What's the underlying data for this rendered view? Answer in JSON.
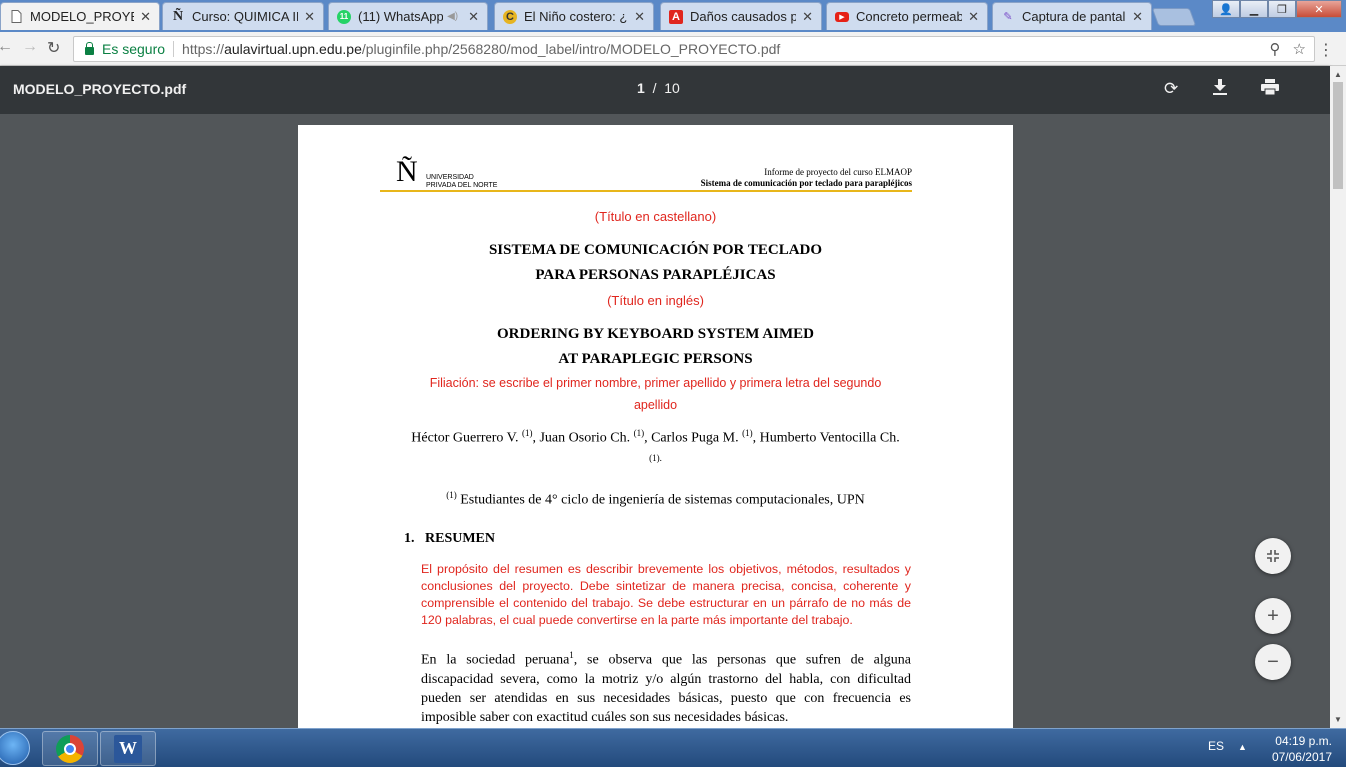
{
  "browser": {
    "tabs": [
      {
        "label": "MODELO_PROYECT",
        "icon": "document-icon",
        "active": true
      },
      {
        "label": "Curso: QUIMICA IN",
        "icon": "upn-icon"
      },
      {
        "label": "(11) WhatsApp",
        "icon": "whatsapp-icon"
      },
      {
        "label": "El Niño costero: ¿Q",
        "icon": "news-icon"
      },
      {
        "label": "Daños causados po",
        "icon": "pdf-icon"
      },
      {
        "label": "Concreto permeabl",
        "icon": "youtube-icon"
      },
      {
        "label": "Captura de pantalla",
        "icon": "pen-icon"
      }
    ],
    "whatsapp_badge": "11",
    "secure_label": "Es seguro",
    "url_prefix": "https://",
    "url_host": "aulavirtual.upn.edu.pe",
    "url_path": "/pluginfile.php/2568280/mod_label/intro/MODELO_PROYECTO.pdf"
  },
  "pdf_toolbar": {
    "filename": "MODELO_PROYECTO.pdf",
    "current_page": "1",
    "page_sep": "/",
    "total_pages": "10"
  },
  "document": {
    "logo_letter": "Ñ",
    "logo_line1": "UNIVERSIDAD",
    "logo_line2": "PRIVADA DEL NORTE",
    "header_line1": "Informe de proyecto del curso ELMAOP",
    "header_line2": "Sistema de comunicación por teclado para parapléjicos",
    "title_es_note": "(Título en castellano)",
    "title_es_1": "SISTEMA DE COMUNICACIÓN POR TECLADO",
    "title_es_2": "PARA PERSONAS PARAPLÉJICAS",
    "title_en_note": "(Título en inglés)",
    "title_en_1": "ORDERING BY KEYBOARD SYSTEM AIMED",
    "title_en_2": "AT PARAPLEGIC PERSONS",
    "affiliation_note_1": "Filiación: se escribe el primer nombre, primer apellido y primera letra del segundo",
    "affiliation_note_2": "apellido",
    "author_1": "Héctor Guerrero V.",
    "author_2": "Juan Osorio Ch.",
    "author_3": "Carlos Puga M.",
    "author_4": "Humberto Ventocilla Ch.",
    "affil_mark": "(1)",
    "affiliation": "Estudiantes de 4° ciclo de ingeniería de sistemas computacionales, UPN",
    "section_number": "1.",
    "section_title": "RESUMEN",
    "abstract_instructions": "El propósito del resumen es describir brevemente los objetivos, métodos, resultados y conclusiones del proyecto. Debe sintetizar de manera precisa, concisa, coherente y comprensible el contenido del trabajo. Se debe estructurar en un párrafo de no más de 120 palabras, el cual puede convertirse en la parte más importante del trabajo.",
    "body_start": "En la sociedad peruana",
    "body_footnote": "1",
    "body_rest": ", se observa que las personas que sufren de alguna discapacidad severa, como la motriz y/o algún trastorno del habla, con dificultad pueden ser atendidas en sus necesidades básicas, puesto que con frecuencia es imposible saber con exactitud cuáles son sus necesidades básicas."
  },
  "taskbar": {
    "language": "ES",
    "time": "04:19 p.m.",
    "date": "07/06/2017"
  },
  "colors": {
    "pdf_toolbar": "#323639",
    "viewer_bg": "#525659",
    "red_note": "#e0261e",
    "header_rule": "#e8b61a",
    "secure_green": "#0b8043"
  }
}
